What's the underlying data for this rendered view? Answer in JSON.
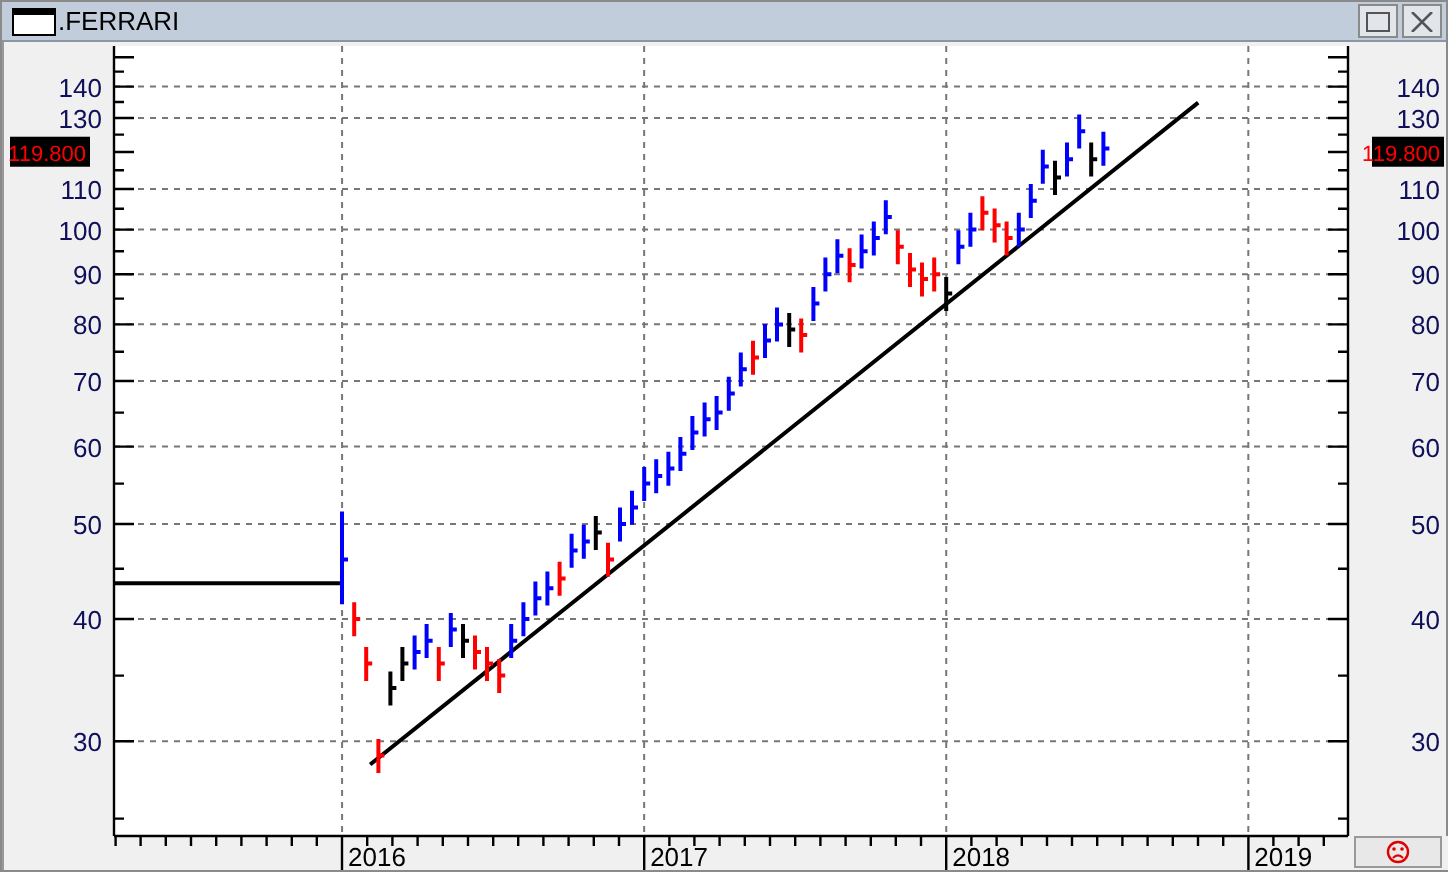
{
  "window": {
    "title": ".FERRARI"
  },
  "chart": {
    "y_axis_left": {
      "labels": [
        "140",
        "130",
        "110",
        "100",
        "90",
        "80",
        "70",
        "60",
        "50",
        "40",
        "30"
      ],
      "last_price": "119.800"
    },
    "y_axis_right": {
      "labels": [
        "140",
        "130",
        "110",
        "100",
        "90",
        "80",
        "70",
        "60",
        "50",
        "40",
        "30"
      ],
      "last_price": "119.800"
    },
    "x_axis": {
      "labels": [
        "2016",
        "2017",
        "2018",
        "2019"
      ]
    }
  }
}
